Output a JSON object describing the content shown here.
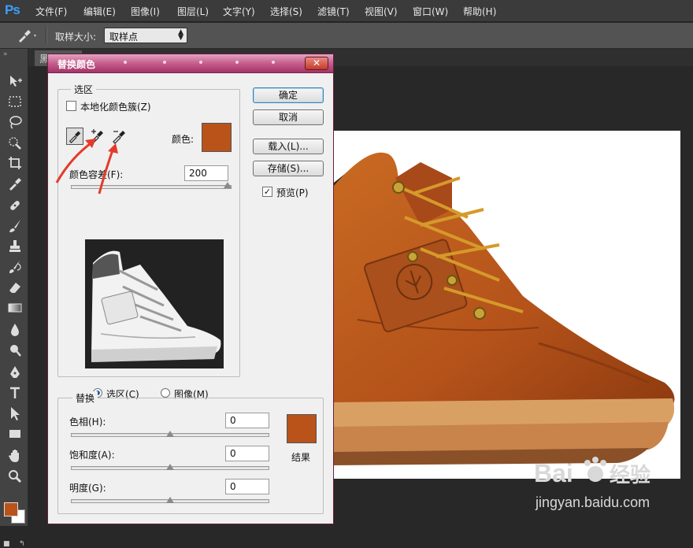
{
  "app": {
    "logo": "Ps"
  },
  "menu": [
    "文件(F)",
    "编辑(E)",
    "图像(I)",
    "图层(L)",
    "文字(Y)",
    "选择(S)",
    "滤镜(T)",
    "视图(V)",
    "窗口(W)",
    "帮助(H)"
  ],
  "options_bar": {
    "tool_icon": "eyedropper-icon",
    "sample_size_label": "取样大小:",
    "sample_size_value": "取样点"
  },
  "document": {
    "tab_title": "黑"
  },
  "toolbar": {
    "tools": [
      "move-icon",
      "marquee-icon",
      "lasso-icon",
      "quick-select-icon",
      "crop-icon",
      "eyedropper-icon",
      "healing-brush-icon",
      "brush-icon",
      "clone-stamp-icon",
      "history-brush-icon",
      "eraser-icon",
      "gradient-icon",
      "blur-icon",
      "dodge-icon",
      "pen-icon",
      "type-icon",
      "path-select-icon",
      "shape-icon",
      "hand-icon",
      "zoom-icon"
    ],
    "foreground_color": "#b9531a",
    "background_color": "#ffffff"
  },
  "dialog": {
    "title": "替换颜色",
    "selection": {
      "legend": "选区",
      "localized_label": "本地化颜色簇(Z)",
      "localized_checked": false,
      "color_label": "颜色:",
      "color_swatch": "#b9531a",
      "eyedroppers": [
        "eyedropper-icon",
        "eyedropper-plus-icon",
        "eyedropper-minus-icon"
      ],
      "fuzziness_label": "颜色容差(F):",
      "fuzziness_value": "200",
      "fuzziness_level": 1.0,
      "radio_selection": "选区(C)",
      "radio_image": "图像(M)",
      "selected_mode": "选区(C)"
    },
    "buttons": {
      "ok": "确定",
      "cancel": "取消",
      "load": "载入(L)...",
      "save": "存储(S)..."
    },
    "preview": {
      "label": "预览(P)",
      "checked": true
    },
    "replacement": {
      "legend": "替换",
      "hue_label": "色相(H):",
      "hue_value": "0",
      "saturation_label": "饱和度(A):",
      "saturation_value": "0",
      "lightness_label": "明度(G):",
      "lightness_value": "0",
      "result_label": "结果",
      "result_color": "#b9531a"
    }
  },
  "watermark": {
    "brand": "Bai",
    "brand2": "经验",
    "url": "jingyan.baidu.com"
  }
}
